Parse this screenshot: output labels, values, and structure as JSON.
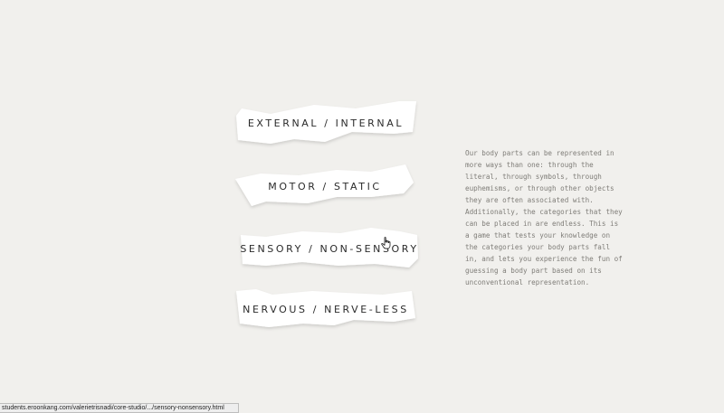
{
  "categories": [
    {
      "label": "EXTERNAL / INTERNAL"
    },
    {
      "label": "MOTOR / STATIC"
    },
    {
      "label": "SENSORY / NON-SENSORY"
    },
    {
      "label": "NERVOUS / NERVE-LESS"
    }
  ],
  "description": "Our body parts can be represented in more ways than one: through the literal, through symbols, through euphemisms, or through other objects they are often associated with. Additionally, the categories that they can be placed in are endless. This is a game that tests your knowledge on the categories your body parts fall in, and lets you experience the fun of guessing a body part based on its unconventional representation.",
  "status_bar": {
    "url": "students.eroonkang.com/valerietrisnadi/core-studio/.../sensory-nonsensory.html"
  },
  "colors": {
    "background": "#f1f0ed",
    "card": "#ffffff",
    "text": "#2b2b2b",
    "description_text": "#7f7d78"
  },
  "icons": {
    "cursor": "hand-pointer-icon"
  }
}
